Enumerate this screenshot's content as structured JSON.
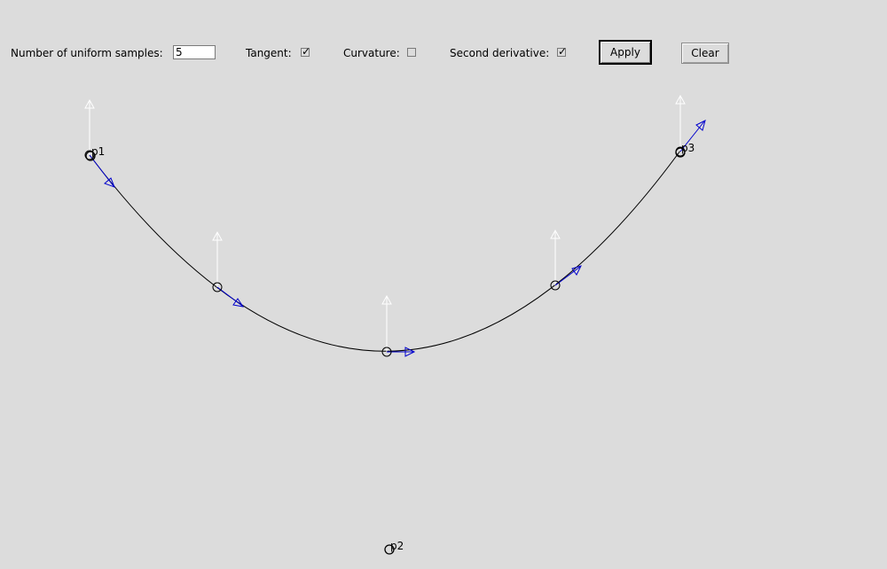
{
  "toolbar": {
    "samples_label": "Number of uniform samples:",
    "samples_value": "5",
    "tangent_label": "Tangent:",
    "tangent_checked": true,
    "curvature_label": "Curvature:",
    "curvature_checked": false,
    "second_derivative_label": "Second derivative:",
    "second_derivative_checked": true,
    "apply_label": "Apply",
    "clear_label": "Clear"
  },
  "canvas": {
    "control_points": [
      {
        "label": "p1"
      },
      {
        "label": "p2"
      },
      {
        "label": "p3"
      }
    ],
    "colors": {
      "curve": "#000000",
      "tangent": "#0000cc",
      "second_derivative": "#ffffff"
    }
  }
}
